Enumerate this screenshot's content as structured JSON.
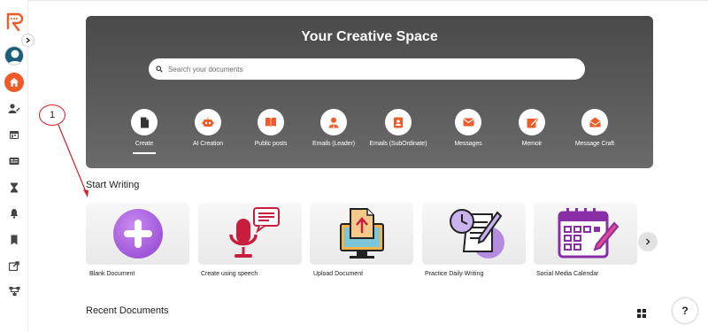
{
  "hero": {
    "title": "Your Creative Space",
    "search_placeholder": "Search your documents"
  },
  "categories": [
    {
      "label": "Create",
      "icon": "document-icon"
    },
    {
      "label": "AI Creation",
      "icon": "robot-icon"
    },
    {
      "label": "Public posts",
      "icon": "book-icon"
    },
    {
      "label": "Emails (Leader)",
      "icon": "user-icon"
    },
    {
      "label": "Emails (SubOrdinate)",
      "icon": "contact-icon"
    },
    {
      "label": "Messages",
      "icon": "envelope-icon"
    },
    {
      "label": "Memoir",
      "icon": "edit-icon"
    },
    {
      "label": "Message Craft",
      "icon": "open-envelope-icon"
    }
  ],
  "start_writing": {
    "title": "Start Writing",
    "cards": [
      {
        "label": "Blank Document",
        "icon": "plus-icon"
      },
      {
        "label": "Create using speech",
        "icon": "microphone-icon"
      },
      {
        "label": "Upload Document",
        "icon": "upload-icon"
      },
      {
        "label": "Practice Daily Writing",
        "icon": "notepad-clock-icon"
      },
      {
        "label": "Social Media Calendar",
        "icon": "calendar-icon"
      }
    ]
  },
  "recent": {
    "title": "Recent Documents"
  },
  "help_label": "?",
  "annotation": {
    "label": "1"
  },
  "colors": {
    "accent": "#f05a28",
    "annotation": "#d62020"
  }
}
